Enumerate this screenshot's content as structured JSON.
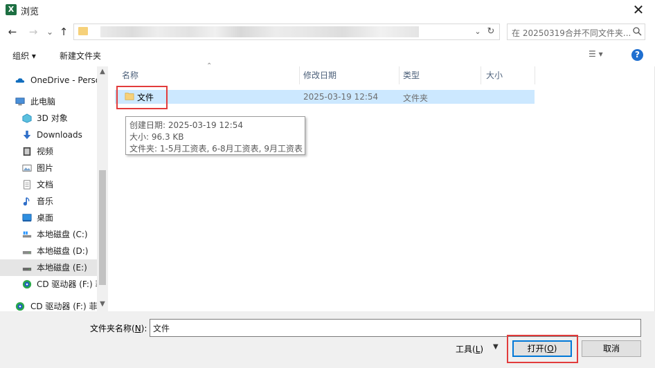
{
  "window": {
    "title": "浏览",
    "app_icon_letter": "X",
    "close_glyph": "✕"
  },
  "nav": {
    "back": "←",
    "forward": "→",
    "recent": "⌄",
    "up": "↑",
    "address_chevron": "⌄",
    "refresh": "↻"
  },
  "search": {
    "placeholder": "在 20250319合并不同文件夹..."
  },
  "toolbar": {
    "organize_label": "组织 ▾",
    "new_folder_label": "新建文件夹",
    "view_label": "☰ ▾",
    "help_label": "?"
  },
  "sidebar": {
    "items": [
      {
        "label": "OneDrive - Perso",
        "icon": "cloud-icon"
      },
      {
        "label": "此电脑",
        "icon": "computer-icon"
      },
      {
        "label": "3D 对象",
        "icon": "3d-objects-icon"
      },
      {
        "label": "Downloads",
        "icon": "download-icon"
      },
      {
        "label": "视频",
        "icon": "video-icon"
      },
      {
        "label": "图片",
        "icon": "picture-icon"
      },
      {
        "label": "文档",
        "icon": "document-icon"
      },
      {
        "label": "音乐",
        "icon": "music-icon"
      },
      {
        "label": "桌面",
        "icon": "desktop-icon"
      },
      {
        "label": "本地磁盘 (C:)",
        "icon": "drive-icon"
      },
      {
        "label": "本地磁盘 (D:)",
        "icon": "drive-icon"
      },
      {
        "label": "本地磁盘 (E:)",
        "icon": "drive-icon"
      },
      {
        "label": "CD 驱动器 (F:) 菲",
        "icon": "cd-drive-icon"
      },
      {
        "label": "CD 驱动器 (F:) 菲",
        "icon": "cd-drive-icon"
      }
    ]
  },
  "columns": {
    "name": "名称",
    "modified": "修改日期",
    "type": "类型",
    "size": "大小"
  },
  "files": [
    {
      "name": "文件",
      "modified": "2025-03-19 12:54",
      "type": "文件夹"
    }
  ],
  "tooltip": {
    "created": "创建日期: 2025-03-19 12:54",
    "size": "大小: 96.3 KB",
    "folders": "文件夹: 1-5月工资表, 6-8月工资表, 9月工资表"
  },
  "footer": {
    "filename_label_prefix": "文件夹名称(",
    "filename_label_key": "N",
    "filename_label_suffix": "):",
    "filename_value": "文件",
    "tools_prefix": "工具(",
    "tools_key": "L",
    "tools_suffix": ")",
    "open_prefix": "打开(",
    "open_key": "O",
    "open_suffix": ")",
    "cancel_label": "取消"
  },
  "colors": {
    "selection": "#cce8ff",
    "highlight_box": "#e23b3b",
    "accent": "#0078d7",
    "folder": "#f6d17a"
  }
}
